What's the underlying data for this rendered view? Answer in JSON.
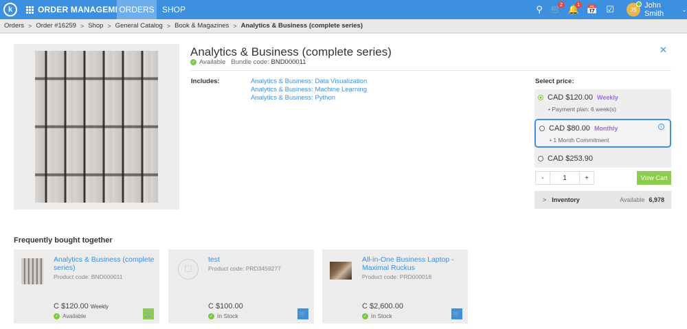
{
  "topbar": {
    "logo": "k",
    "app_title": "ORDER MANAGEMENT",
    "nav_orders": "ORDERS",
    "nav_shop": "SHOP",
    "cart_count": "2",
    "notif_count": "1",
    "avatar_initials": "JS",
    "user_name": "John Smith",
    "colors": {
      "bar": "#3d8fe0",
      "active_tab": "#6eaeec"
    }
  },
  "breadcrumb": [
    "Orders",
    "Order #16259",
    "Shop",
    "General Catalog",
    "Book & Magazines",
    "Analytics & Business (complete series)"
  ],
  "product": {
    "title": "Analytics & Business (complete series)",
    "availability": "Available",
    "bundle_label": "Bundle code:",
    "bundle_code": "BND000011",
    "includes_label": "Includes:",
    "includes": [
      "Analytics & Business: Data Visualization",
      "Analytics & Business: Machine Learning",
      "Analytics & Business: Python"
    ]
  },
  "pricing": {
    "select_label": "Select price:",
    "options": [
      {
        "price": "CAD $120.00",
        "frequency": "Weekly",
        "note": "• Payment plan: 6 week(s)",
        "selected": true
      },
      {
        "price": "CAD $80.00",
        "frequency": "Monthly",
        "note": "• 1 Month Commitment",
        "selected": false
      },
      {
        "price": "CAD $253.90",
        "frequency": "",
        "note": "",
        "selected": false
      }
    ],
    "qty_minus": "-",
    "qty_value": "1",
    "qty_plus": "+",
    "view_cart": "View Cart",
    "inventory_label": "Inventory",
    "available_label": "Available",
    "available_count": "6,978"
  },
  "frequently_bought": {
    "heading": "Frequently bought together",
    "items": [
      {
        "name": "Analytics & Business (complete series)",
        "code": "Product code: BND000011",
        "price": "C $120.00",
        "freq": "Weekly",
        "stock": "Available",
        "btn_color": "#8dcc4e"
      },
      {
        "name": "test",
        "code": "Product code: PRD3459277",
        "price": "C $100.00",
        "freq": "",
        "stock": "In Stock",
        "btn_color": "#3d8fe0"
      },
      {
        "name": "All-in-One Business Laptop - Maximal Ruckus",
        "code": "Product code: PRD000018",
        "price": "C $2,600.00",
        "freq": "",
        "stock": "In Stock",
        "btn_color": "#3d8fe0"
      }
    ]
  }
}
